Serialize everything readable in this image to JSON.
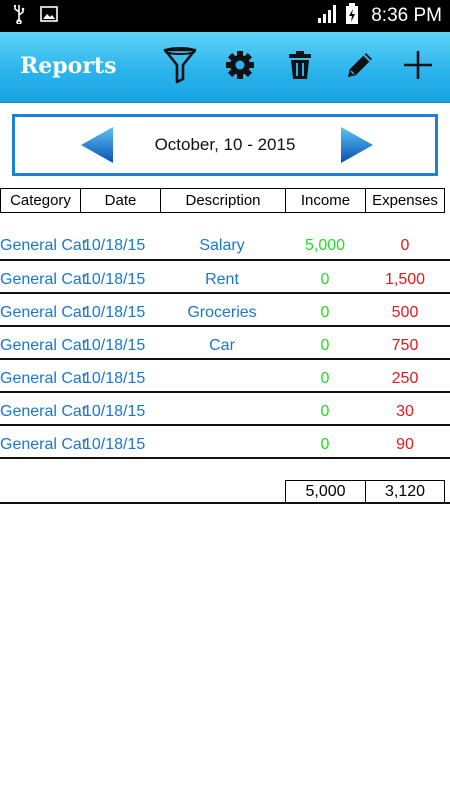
{
  "status_bar": {
    "left_icons": [
      "usb-icon",
      "image-icon"
    ],
    "right_icons": [
      "signal-icon",
      "battery-icon"
    ],
    "time": "8:36 PM"
  },
  "action_bar": {
    "title": "Reports",
    "actions": [
      "filter-icon",
      "gear-icon",
      "trash-icon",
      "pencil-icon",
      "plus-icon"
    ]
  },
  "date_selector": {
    "label": "October,  10 - 2015"
  },
  "table": {
    "headers": [
      "Category",
      "Date",
      "Description",
      "Income",
      "Expenses"
    ],
    "rows": [
      {
        "category": "General Cat",
        "date": "10/18/15",
        "description": "Salary",
        "income": "5,000",
        "expense": "0"
      },
      {
        "category": "General Cat",
        "date": "10/18/15",
        "description": "Rent",
        "income": "0",
        "expense": "1,500"
      },
      {
        "category": "General Cat",
        "date": "10/18/15",
        "description": "Groceries",
        "income": "0",
        "expense": "500"
      },
      {
        "category": "General Cat",
        "date": "10/18/15",
        "description": "Car",
        "income": "0",
        "expense": "750"
      },
      {
        "category": "General Cat",
        "date": "10/18/15",
        "description": "",
        "income": "0",
        "expense": "250"
      },
      {
        "category": "General Cat",
        "date": "10/18/15",
        "description": "",
        "income": "0",
        "expense": "30"
      },
      {
        "category": "General Cat",
        "date": "10/18/15",
        "description": "",
        "income": "0",
        "expense": "90"
      }
    ],
    "totals": {
      "income": "5,000",
      "expense": "3,120"
    }
  },
  "colors": {
    "action_bar": "#2bb4ec",
    "link_blue": "#1877d2",
    "income_green": "#22dd22",
    "expense_red": "#e21a1a",
    "panel_border": "#1e7fd8"
  }
}
